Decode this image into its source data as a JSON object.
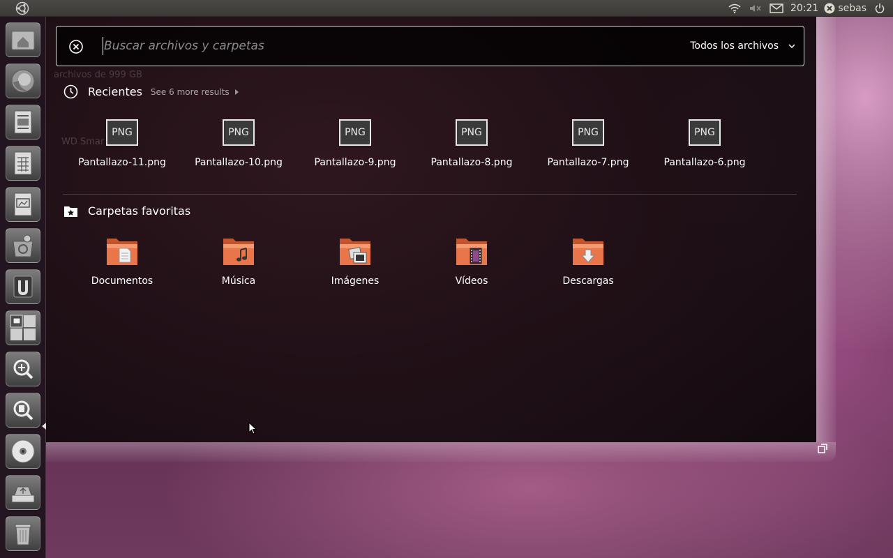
{
  "panel": {
    "clock": "20:21",
    "username": "sebas"
  },
  "launcher": {
    "items": [
      {
        "icon": "home-folder-icon"
      },
      {
        "icon": "firefox-icon"
      },
      {
        "icon": "writer-icon"
      },
      {
        "icon": "calc-icon"
      },
      {
        "icon": "impress-icon"
      },
      {
        "icon": "software-center-icon"
      },
      {
        "icon": "ubuntu-one-icon"
      },
      {
        "icon": "workspaces-icon"
      },
      {
        "icon": "apps-lens-icon"
      },
      {
        "icon": "files-lens-icon"
      },
      {
        "icon": "disc-icon"
      },
      {
        "icon": "usb-drive-icon"
      },
      {
        "icon": "trash-icon"
      }
    ]
  },
  "search": {
    "placeholder": "Buscar archivos y carpetas",
    "value": "",
    "filter_label": "Todos los archivos"
  },
  "background_ghost": {
    "line1": "archivos de 999 GB",
    "line2": "WD Smar"
  },
  "recents": {
    "title": "Recientes",
    "see_more": "See 6 more results",
    "items": [
      {
        "label": "Pantallazo-11.png",
        "badge": "PNG"
      },
      {
        "label": "Pantallazo-10.png",
        "badge": "PNG"
      },
      {
        "label": "Pantallazo-9.png",
        "badge": "PNG"
      },
      {
        "label": "Pantallazo-8.png",
        "badge": "PNG"
      },
      {
        "label": "Pantallazo-7.png",
        "badge": "PNG"
      },
      {
        "label": "Pantallazo-6.png",
        "badge": "PNG"
      }
    ]
  },
  "favorites": {
    "title": "Carpetas favoritas",
    "items": [
      {
        "label": "Documentos",
        "icon": "documents-folder-icon"
      },
      {
        "label": "Música",
        "icon": "music-folder-icon"
      },
      {
        "label": "Imágenes",
        "icon": "pictures-folder-icon"
      },
      {
        "label": "Vídeos",
        "icon": "videos-folder-icon"
      },
      {
        "label": "Descargas",
        "icon": "downloads-folder-icon"
      }
    ]
  },
  "colors": {
    "folder_orange": "#e8764a",
    "panel_bg": "#3c3b37",
    "dash_border": "#ffffff"
  }
}
